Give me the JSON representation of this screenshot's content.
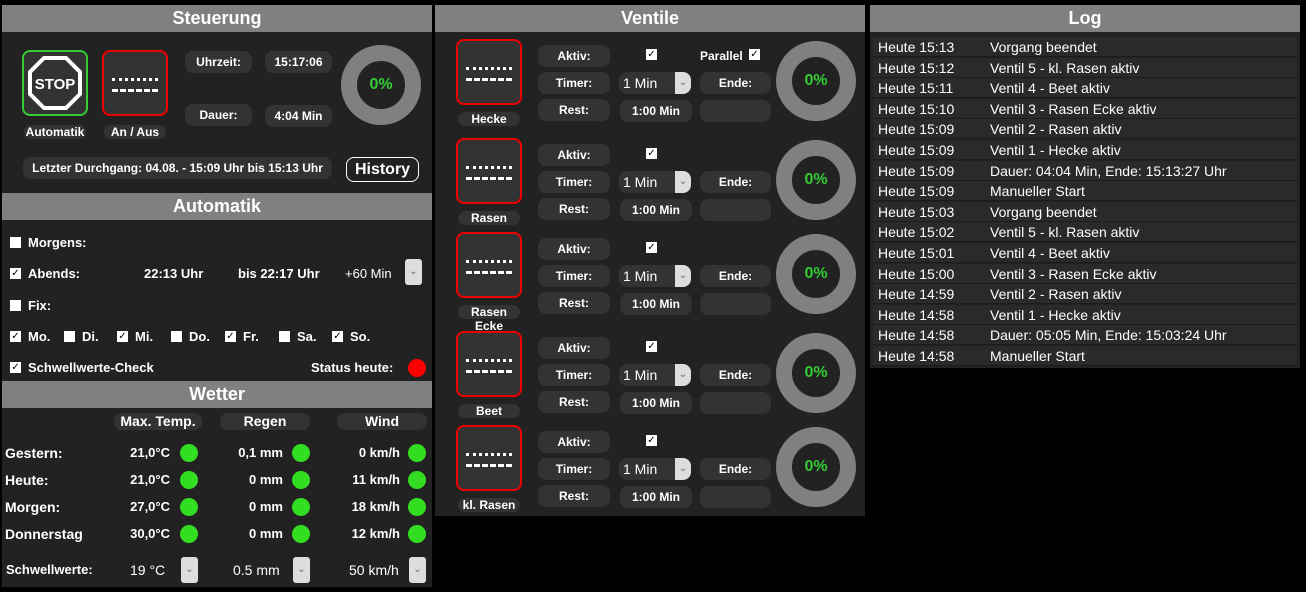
{
  "steuerung": {
    "title": "Steuerung",
    "automatik_label": "Automatik",
    "anaus_label": "An / Aus",
    "uhrzeit_label": "Uhrzeit:",
    "uhrzeit": "15:17:06",
    "dauer_label": "Dauer:",
    "dauer": "4:04 Min",
    "progress": "0%",
    "letzter": "Letzter Durchgang: 04.08. - 15:09 Uhr bis 15:13 Uhr",
    "history": "History",
    "stop_text": "STOP"
  },
  "automatik": {
    "title": "Automatik",
    "morgens": "Morgens:",
    "morgens_checked": false,
    "abends": "Abends:",
    "abends_checked": true,
    "abends_start": "22:13 Uhr",
    "abends_end": "bis 22:17 Uhr",
    "offset": "+60 Min",
    "fix": "Fix:",
    "fix_checked": false,
    "days": [
      {
        "label": "Mo.",
        "checked": true
      },
      {
        "label": "Di.",
        "checked": false
      },
      {
        "label": "Mi.",
        "checked": true
      },
      {
        "label": "Do.",
        "checked": false
      },
      {
        "label": "Fr.",
        "checked": true
      },
      {
        "label": "Sa.",
        "checked": false
      },
      {
        "label": "So.",
        "checked": true
      }
    ],
    "schwell": "Schwellwerte-Check",
    "schwell_checked": true,
    "status": "Status heute:",
    "status_color": "#ff0000"
  },
  "wetter": {
    "title": "Wetter",
    "cols": [
      "Max. Temp.",
      "Regen",
      "Wind"
    ],
    "rows": [
      {
        "label": "Gestern:",
        "temp": "21,0°C",
        "rain": "0,1 mm",
        "wind": "0 km/h"
      },
      {
        "label": "Heute:",
        "temp": "21,0°C",
        "rain": "0 mm",
        "wind": "11 km/h"
      },
      {
        "label": "Morgen:",
        "temp": "27,0°C",
        "rain": "0 mm",
        "wind": "18 km/h"
      },
      {
        "label": "Donnerstag",
        "temp": "30,0°C",
        "rain": "0 mm",
        "wind": "12 km/h"
      }
    ],
    "schwell_label": "Schwellwerte:",
    "schwell_temp": "19 °C",
    "schwell_rain": "0.5 mm",
    "schwell_wind": "50 km/h",
    "ok_color": "#33dd22"
  },
  "ventile": {
    "title": "Ventile",
    "aktiv": "Aktiv:",
    "timer": "Timer:",
    "rest": "Rest:",
    "ende": "Ende:",
    "parallel": "Parallel",
    "parallel_checked": true,
    "items": [
      {
        "name": "Hecke",
        "timer": "1 Min",
        "rest": "1:00 Min",
        "progress": "0%"
      },
      {
        "name": "Rasen",
        "timer": "1 Min",
        "rest": "1:00 Min",
        "progress": "0%"
      },
      {
        "name": "Rasen Ecke",
        "timer": "1 Min",
        "rest": "1:00 Min",
        "progress": "0%"
      },
      {
        "name": "Beet",
        "timer": "1 Min",
        "rest": "1:00 Min",
        "progress": "0%"
      },
      {
        "name": "kl. Rasen",
        "timer": "1 Min",
        "rest": "1:00 Min",
        "progress": "0%"
      }
    ]
  },
  "log": {
    "title": "Log",
    "entries": [
      [
        "Heute 15:13",
        "Vorgang beendet"
      ],
      [
        "Heute 15:12",
        "Ventil 5 - kl. Rasen aktiv"
      ],
      [
        "Heute 15:11",
        "Ventil 4 - Beet aktiv"
      ],
      [
        "Heute 15:10",
        "Ventil 3 - Rasen Ecke aktiv"
      ],
      [
        "Heute 15:09",
        "Ventil 2 - Rasen aktiv"
      ],
      [
        "Heute 15:09",
        "Ventil 1 - Hecke aktiv"
      ],
      [
        "Heute 15:09",
        "Dauer: 04:04 Min, Ende: 15:13:27 Uhr"
      ],
      [
        "Heute 15:09",
        "Manueller Start"
      ],
      [
        "Heute 15:03",
        "Vorgang beendet"
      ],
      [
        "Heute 15:02",
        "Ventil 5 - kl. Rasen aktiv"
      ],
      [
        "Heute 15:01",
        "Ventil 4 - Beet aktiv"
      ],
      [
        "Heute 15:00",
        "Ventil 3 - Rasen Ecke aktiv"
      ],
      [
        "Heute 14:59",
        "Ventil 2 - Rasen aktiv"
      ],
      [
        "Heute 14:58",
        "Ventil 1 - Hecke aktiv"
      ],
      [
        "Heute 14:58",
        "Dauer: 05:05 Min, Ende: 15:03:24 Uhr"
      ],
      [
        "Heute 14:58",
        "Manueller Start"
      ]
    ]
  }
}
